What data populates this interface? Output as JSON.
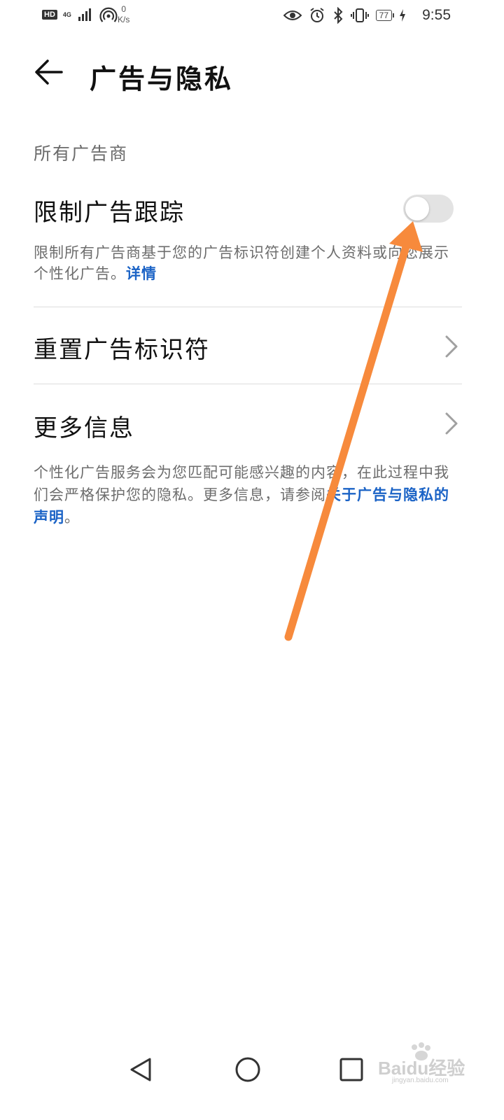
{
  "status_bar": {
    "hd": "HD",
    "network": "4G",
    "speed_value": "0",
    "speed_unit": "K/s",
    "battery": "77",
    "time": "9:55",
    "icons": [
      "hd-icon",
      "signal-icon",
      "hotspot-icon",
      "eye-icon",
      "alarm-icon",
      "bluetooth-icon",
      "vibrate-icon",
      "battery-icon",
      "charging-icon"
    ]
  },
  "header": {
    "title": "广告与隐私",
    "back_icon": "back-arrow-icon"
  },
  "section": {
    "label": "所有广告商"
  },
  "limit_tracking": {
    "title": "限制广告跟踪",
    "description": "限制所有广告商基于您的广告标识符创建个人资料或向您展示个性化广告。",
    "link": "详情",
    "toggle_on": false
  },
  "reset_id": {
    "title": "重置广告标识符"
  },
  "more_info": {
    "title": "更多信息"
  },
  "footer": {
    "text": "个性化广告服务会为您匹配可能感兴趣的内容，在此过程中我们会严格保护您的隐私。更多信息，请参阅",
    "link": "关于广告与隐私的声明",
    "end": "。"
  },
  "nav_bar": {
    "icons": [
      "back-triangle-icon",
      "home-circle-icon",
      "recents-square-icon"
    ]
  },
  "watermark": {
    "text": "Baidu经验",
    "sub": "jingyan.baidu.com"
  },
  "annotation": {
    "arrow_color": "#f78a3c"
  }
}
